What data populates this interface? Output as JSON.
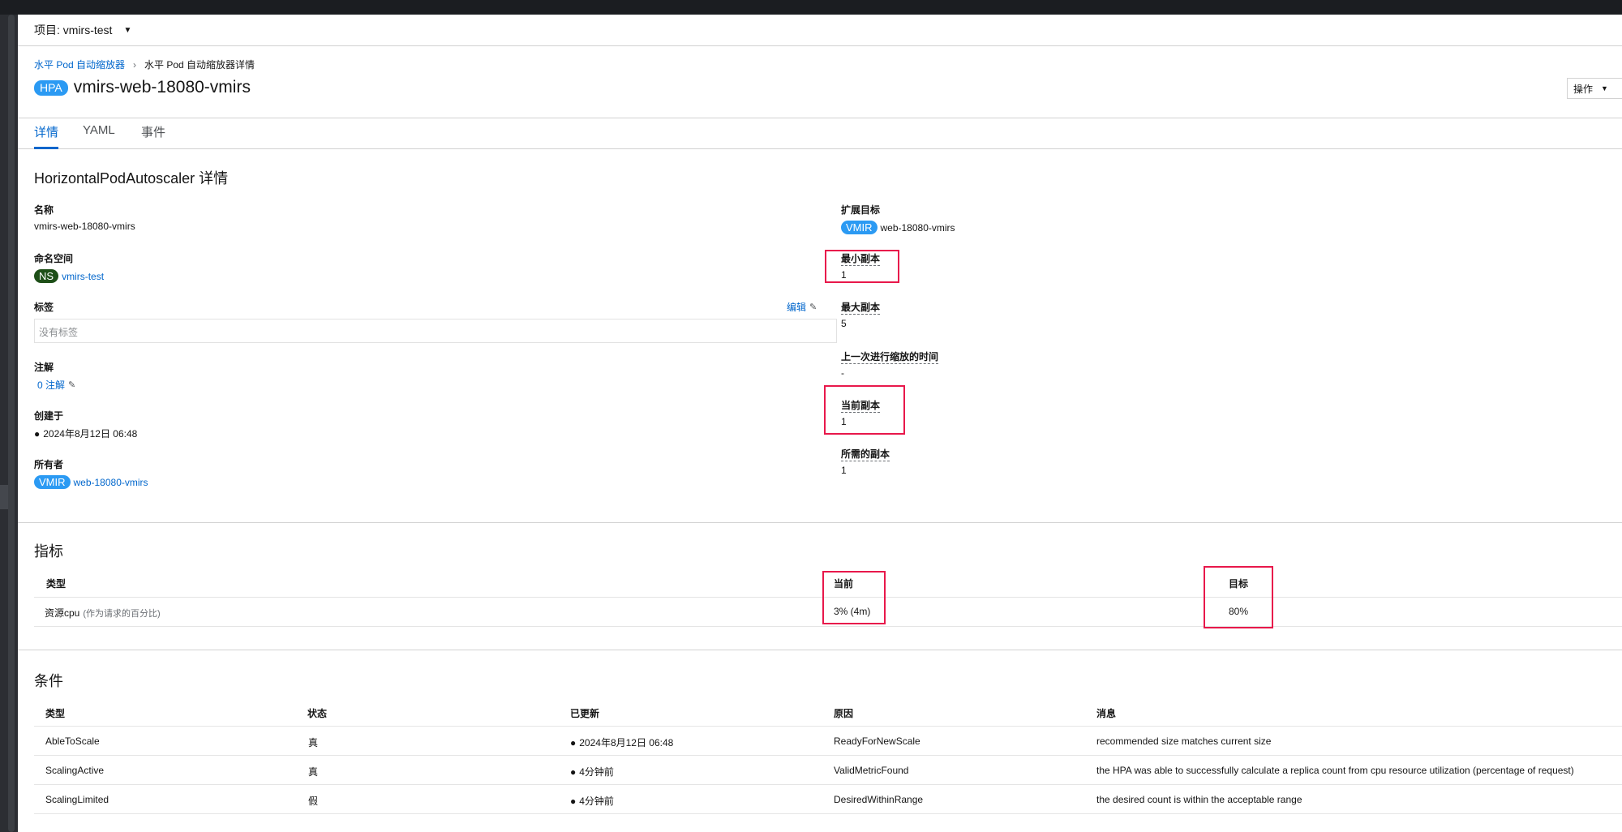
{
  "project_bar": {
    "label": "项目: vmirs-test"
  },
  "breadcrumb": {
    "parent": "水平 Pod 自动缩放器",
    "current": "水平 Pod 自动缩放器详情"
  },
  "header": {
    "badge": "HPA",
    "title": "vmirs-web-18080-vmirs",
    "actions_label": "操作"
  },
  "tabs": [
    "详情",
    "YAML",
    "事件"
  ],
  "details": {
    "section_title": "HorizontalPodAutoscaler 详情",
    "name_label": "名称",
    "name_value": "vmirs-web-18080-vmirs",
    "namespace_label": "命名空间",
    "namespace_badge": "NS",
    "namespace_value": "vmirs-test",
    "labels_label": "标签",
    "labels_edit": "编辑",
    "labels_empty": "没有标签",
    "annotations_label": "注解",
    "annotations_value": "0 注解",
    "created_label": "创建于",
    "created_value": "2024年8月12日 06:48",
    "owner_label": "所有者",
    "owner_badge": "VMIR",
    "owner_value": "web-18080-vmirs",
    "scale_target_label": "扩展目标",
    "scale_target_badge": "VMIR",
    "scale_target_value": "web-18080-vmirs",
    "min_replicas_label": "最小副本",
    "min_replicas_value": "1",
    "max_replicas_label": "最大副本",
    "max_replicas_value": "5",
    "last_scale_label": "上一次进行缩放的时间",
    "last_scale_value": "-",
    "current_replicas_label": "当前副本",
    "current_replicas_value": "1",
    "desired_replicas_label": "所需的副本",
    "desired_replicas_value": "1"
  },
  "metrics": {
    "section_title": "指标",
    "headers": [
      "类型",
      "当前",
      "目标"
    ],
    "rows": [
      {
        "type": "资源cpu",
        "type_note": "(作为请求的百分比)",
        "current": "3% (4m)",
        "target": "80%"
      }
    ]
  },
  "conditions": {
    "section_title": "条件",
    "headers": [
      "类型",
      "状态",
      "已更新",
      "原因",
      "消息"
    ],
    "rows": [
      {
        "type": "AbleToScale",
        "status": "真",
        "updated": "2024年8月12日 06:48",
        "reason": "ReadyForNewScale",
        "message": "recommended size matches current size"
      },
      {
        "type": "ScalingActive",
        "status": "真",
        "updated": "4分钟前",
        "reason": "ValidMetricFound",
        "message": "the HPA was able to successfully calculate a replica count from cpu resource utilization (percentage of request)"
      },
      {
        "type": "ScalingLimited",
        "status": "假",
        "updated": "4分钟前",
        "reason": "DesiredWithinRange",
        "message": "the desired count is within the acceptable range"
      }
    ]
  },
  "colors": {
    "link": "#0066cc",
    "badge_blue": "#2b9af3",
    "badge_ns": "#1e4f18",
    "highlight": "#e8184b"
  }
}
